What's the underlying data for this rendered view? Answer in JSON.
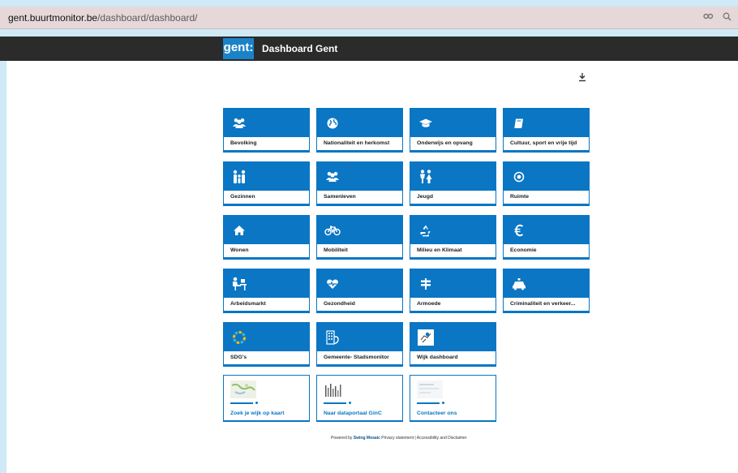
{
  "browser": {
    "url_host": "gent.buurtmonitor.be",
    "url_path": "/dashboard/dashboard/",
    "icons": [
      "key-icon",
      "zoom-icon"
    ]
  },
  "header": {
    "logo_text": "gent:",
    "title": "Dashboard Gent"
  },
  "tiles": [
    {
      "label": "Bevolking",
      "icon": "people-icon"
    },
    {
      "label": "Nationaliteit en herkomst",
      "icon": "globe-icon"
    },
    {
      "label": "Onderwijs en opvang",
      "icon": "graduation-cap-icon"
    },
    {
      "label": "Cultuur, sport en vrije tijd",
      "icon": "book-icon"
    },
    {
      "label": "Gezinnen",
      "icon": "family-icon"
    },
    {
      "label": "Samenleven",
      "icon": "community-icon"
    },
    {
      "label": "Jeugd",
      "icon": "children-icon"
    },
    {
      "label": "Ruimte",
      "icon": "compass-icon"
    },
    {
      "label": "Wonen",
      "icon": "home-icon"
    },
    {
      "label": "Mobiliteit",
      "icon": "bicycle-icon"
    },
    {
      "label": "Milieu en Klimaat",
      "icon": "recycle-icon"
    },
    {
      "label": "Economie",
      "icon": "euro-icon"
    },
    {
      "label": "Arbeidsmarkt",
      "icon": "worker-desk-icon"
    },
    {
      "label": "Gezondheid",
      "icon": "heartbeat-icon"
    },
    {
      "label": "Armoede",
      "icon": "signpost-icon"
    },
    {
      "label": "Criminaliteit en verkeer...",
      "icon": "police-car-icon"
    },
    {
      "label": "SDG's",
      "icon": "sdg-wheel-icon"
    },
    {
      "label": "Gemeente- Stadsmonitor",
      "icon": "building-icon"
    },
    {
      "label": "Wijk dashboard",
      "icon": "map-pin-icon"
    }
  ],
  "link_tiles": [
    {
      "label": "Zoek je wijk op kaart",
      "icon": "map-thumbnail-icon"
    },
    {
      "label": "Naar dataportaal GinC",
      "icon": "chart-thumbnail-icon"
    },
    {
      "label": "Contacteer ons",
      "icon": "contact-thumbnail-icon"
    }
  ],
  "footer": {
    "powered_prefix": "Powered by",
    "powered_by": "Swing Mosaic",
    "links": "Privacy statement | Accessibility and Disclaimer"
  },
  "colors": {
    "accent": "#0a76c4",
    "appbar": "#2b2b2b",
    "urlbar": "#e6d8d8",
    "frame": "#cfe9f7"
  }
}
